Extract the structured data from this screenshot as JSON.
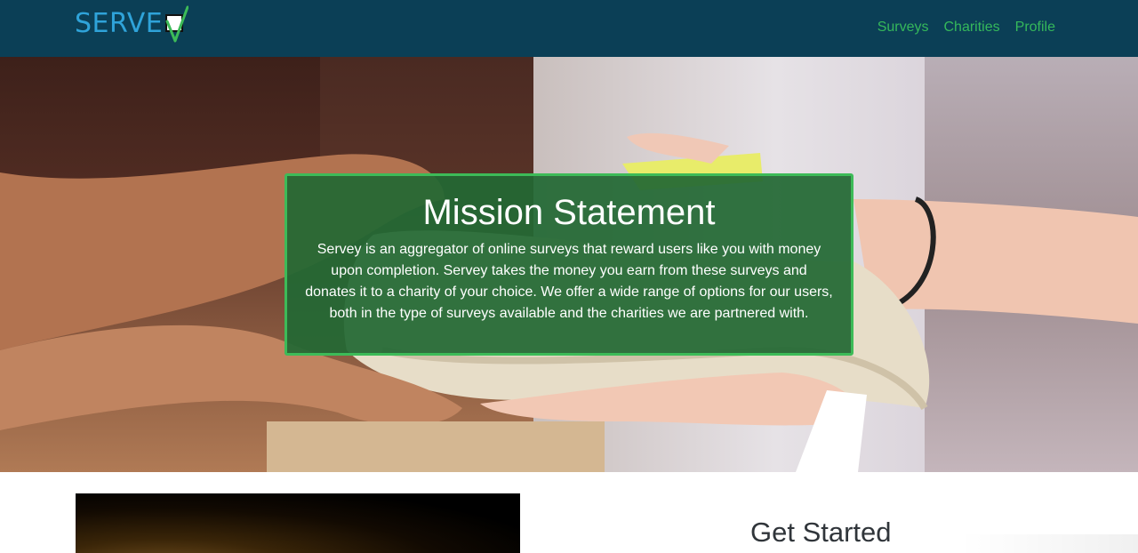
{
  "navbar": {
    "brand": "SERVE",
    "links": [
      {
        "label": "Surveys"
      },
      {
        "label": "Charities"
      },
      {
        "label": "Profile"
      }
    ]
  },
  "hero": {
    "title": "Mission Statement",
    "body": "Servey is an aggregator of online surveys that reward users like you with money upon completion. Servey takes the money you earn from these surveys and donates it to a charity of your choice. We offer a wide range of options for our users, both in the type of surveys available and the charities we are partnered with."
  },
  "lower": {
    "heading": "Get Started"
  },
  "colors": {
    "navbar_bg": "#0b3f56",
    "brand_text": "#2fa3d9",
    "nav_link": "#35b85b",
    "card_bg": "#226834",
    "card_border": "#3dbb58"
  },
  "icons": {
    "logo_checkmark": "check-box-icon"
  }
}
